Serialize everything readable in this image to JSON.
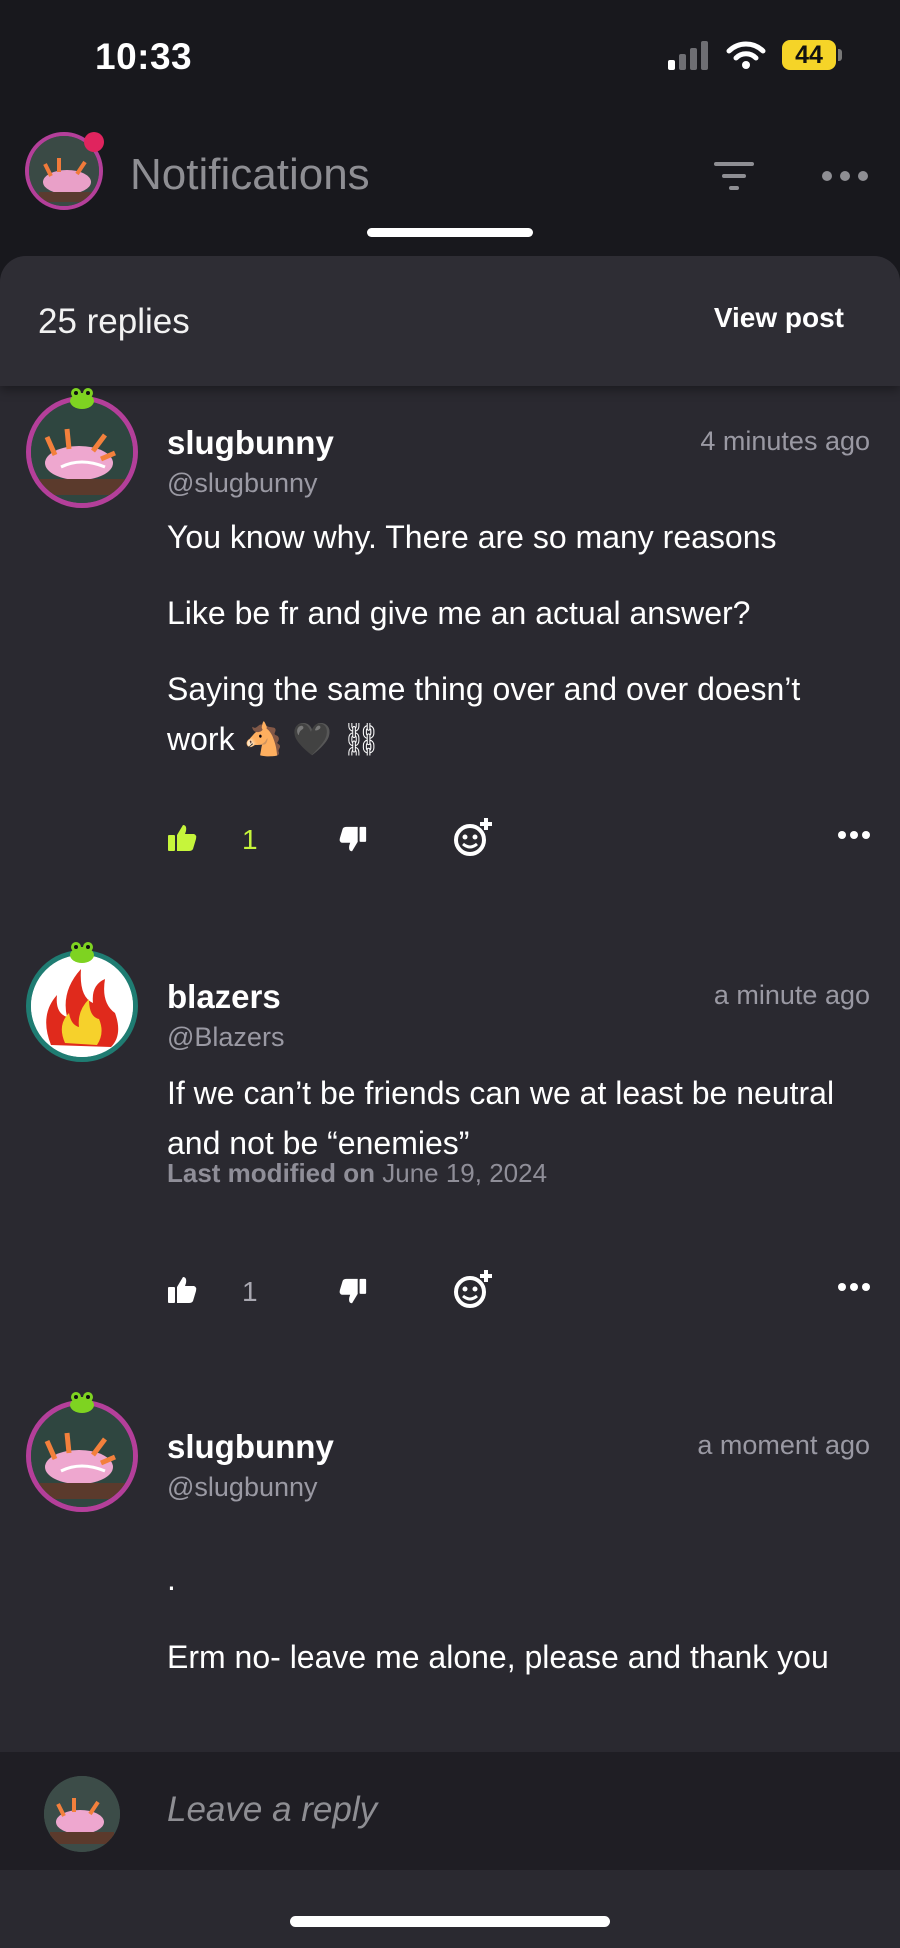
{
  "status_bar": {
    "time": "10:33",
    "battery": "44"
  },
  "header": {
    "title": "Notifications"
  },
  "sheet": {
    "replies_count": "25 replies",
    "view_post_label": "View post"
  },
  "comments": [
    {
      "username": "slugbunny",
      "handle": "@slugbunny",
      "time": "4 minutes ago",
      "lines": [
        "You know why. There are so many reasons",
        "Like be fr and give me an actual answer?",
        "Saying the same thing over and over doesn’t work 🐴 🖤 ⛓"
      ],
      "likes": "1",
      "liked": true
    },
    {
      "username": "blazers",
      "handle": "@Blazers",
      "time": "a minute ago",
      "lines": [
        "If we can’t be friends can we at least be neutral and not be “enemies”"
      ],
      "modified_label": "Last modified on",
      "modified_date": "June 19, 2024",
      "likes": "1",
      "liked": false
    },
    {
      "username": "slugbunny",
      "handle": "@slugbunny",
      "time": "a moment ago",
      "lines": [
        ".",
        "Erm no- leave me alone, please and thank you"
      ]
    }
  ],
  "reply_bar": {
    "placeholder": "Leave a reply"
  },
  "colors": {
    "accent_like": "#c6f53b",
    "background": "#18181d",
    "sheet": "#2a2930",
    "avatar_ring_pink": "#b43f9a",
    "avatar_ring_teal": "#1f7c72"
  }
}
